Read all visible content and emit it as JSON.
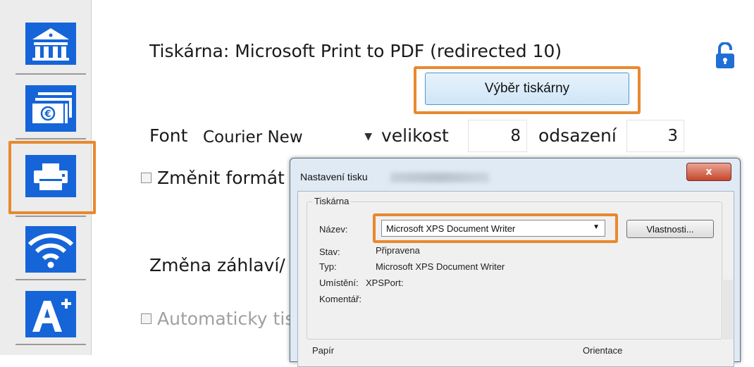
{
  "sidebar": {
    "items": [
      {
        "icon": "bank-icon"
      },
      {
        "icon": "euro-payment-icon"
      },
      {
        "icon": "printer-icon",
        "active": true
      },
      {
        "icon": "wifi-icon"
      },
      {
        "icon": "font-size-icon"
      }
    ]
  },
  "main": {
    "printer_line": "Tiskárna: Microsoft Print to PDF (redirected 10)",
    "lock_icon": "lock-open-icon",
    "select_printer_button": "Výběr tiskárny",
    "font_label": "Font",
    "font_value": "Courier New",
    "size_label": "velikost",
    "size_value": "8",
    "indent_label": "odsazení",
    "indent_value": "3",
    "change_format_label": "Změnit formát",
    "header_change_label": "Změna záhlaví/",
    "auto_print_label": "Automaticky tis"
  },
  "dialog": {
    "title": "Nastavení tisku",
    "close_label": "x",
    "printer_group_title": "Tiskárna",
    "name_label": "Název:",
    "name_value": "Microsoft XPS Document Writer",
    "properties_button": "Vlastnosti...",
    "status_label": "Stav:",
    "status_value": "Připravena",
    "type_label": "Typ:",
    "type_value": "Microsoft XPS Document Writer",
    "location_label": "Umístění:",
    "location_value": "XPSPort:",
    "comment_label": "Komentář:",
    "paper_group_title": "Papír",
    "orientation_group_title": "Orientace"
  },
  "colors": {
    "accent_orange": "#e8892e",
    "icon_blue": "#1565d8"
  }
}
